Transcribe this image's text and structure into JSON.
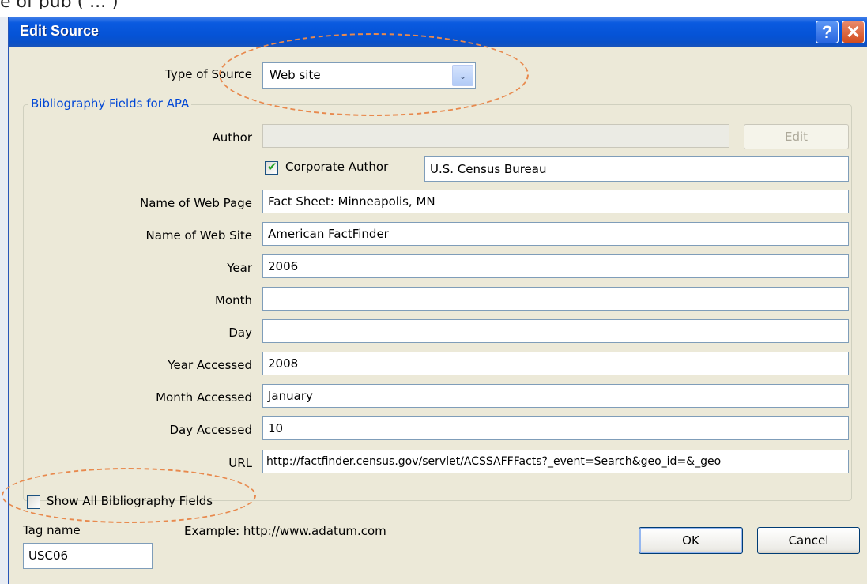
{
  "background": {
    "fragment": "e of pub                                                    ( ...                             )"
  },
  "dialog": {
    "title": "Edit Source",
    "help_glyph": "?",
    "close_glyph": "✕"
  },
  "type_of_source": {
    "label": "Type of Source",
    "value": "Web site",
    "arrow": "⌄"
  },
  "group_title": "Bibliography Fields for APA",
  "author": {
    "label": "Author",
    "value": "",
    "edit_label": "Edit"
  },
  "corporate_author": {
    "label": "Corporate Author",
    "checked": true,
    "checkmark": "✔",
    "value": "U.S. Census Bureau"
  },
  "fields": [
    {
      "label": "Name of Web Page",
      "value": "Fact Sheet: Minneapolis, MN"
    },
    {
      "label": "Name of Web Site",
      "value": "American FactFinder"
    },
    {
      "label": "Year",
      "value": "2006"
    },
    {
      "label": "Month",
      "value": ""
    },
    {
      "label": "Day",
      "value": ""
    },
    {
      "label": "Year Accessed",
      "value": "2008"
    },
    {
      "label": "Month Accessed",
      "value": "January"
    },
    {
      "label": "Day Accessed",
      "value": "10"
    },
    {
      "label": "URL",
      "value": "http://factfinder.census.gov/servlet/ACSSAFFFacts?_event=Search&geo_id=&_geo"
    }
  ],
  "show_all": {
    "label": "Show All Bibliography Fields",
    "checked": false
  },
  "tag": {
    "label": "Tag name",
    "value": "USC06"
  },
  "example": "Example: http://www.adatum.com",
  "buttons": {
    "ok": "OK",
    "cancel": "Cancel"
  },
  "colors": {
    "titlebar": "#0553d6",
    "group_title": "#0046d5",
    "annotation": "#e8894d",
    "dialog_bg": "#ece9d8"
  }
}
